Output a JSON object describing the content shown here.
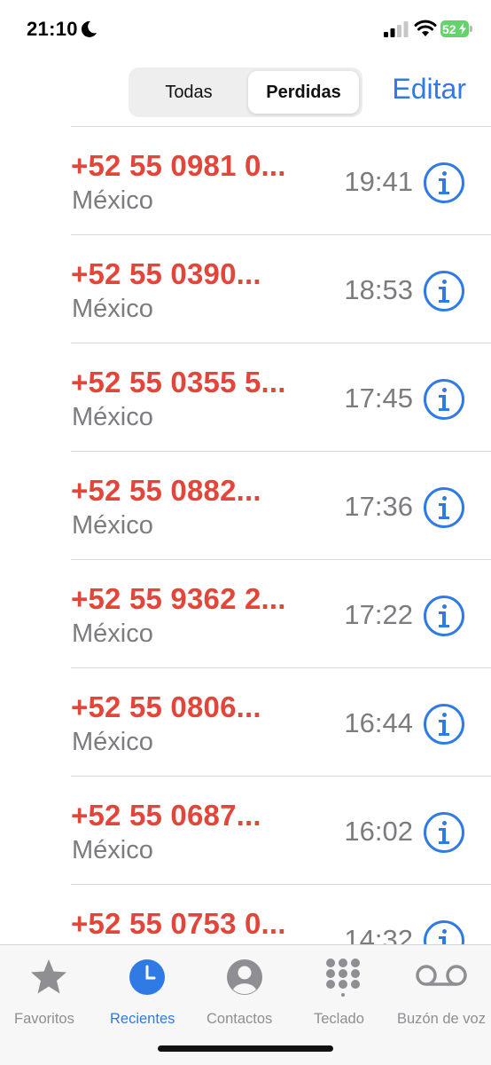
{
  "status_bar": {
    "time": "21:10",
    "battery": "52"
  },
  "header": {
    "segments": [
      "Todas",
      "Perdidas"
    ],
    "selected_segment": "Perdidas",
    "edit_label": "Editar"
  },
  "calls": [
    {
      "number": "+52 55 0981 0...",
      "location": "México",
      "time": "19:41"
    },
    {
      "number": "+52 55 0390...",
      "location": "México",
      "time": "18:53"
    },
    {
      "number": "+52 55 0355 5...",
      "location": "México",
      "time": "17:45"
    },
    {
      "number": "+52 55 0882...",
      "location": "México",
      "time": "17:36"
    },
    {
      "number": "+52 55 9362 2...",
      "location": "México",
      "time": "17:22"
    },
    {
      "number": "+52 55 0806...",
      "location": "México",
      "time": "16:44"
    },
    {
      "number": "+52 55 0687...",
      "location": "México",
      "time": "16:02"
    },
    {
      "number": "+52 55 0753 0...",
      "location": "",
      "time": "14:32"
    }
  ],
  "tab_bar": {
    "tabs": [
      {
        "label": "Favoritos",
        "icon": "star-icon"
      },
      {
        "label": "Recientes",
        "icon": "clock-icon"
      },
      {
        "label": "Contactos",
        "icon": "person-circle-icon"
      },
      {
        "label": "Teclado",
        "icon": "keypad-icon"
      },
      {
        "label": "Buzón de voz",
        "icon": "voicemail-icon"
      }
    ],
    "active_tab": "Recientes"
  },
  "colors": {
    "missed_call_red": "#e2463a",
    "accent_blue": "#2f7ae5",
    "secondary_gray": "#7c7c80",
    "battery_green": "#63d36b"
  }
}
